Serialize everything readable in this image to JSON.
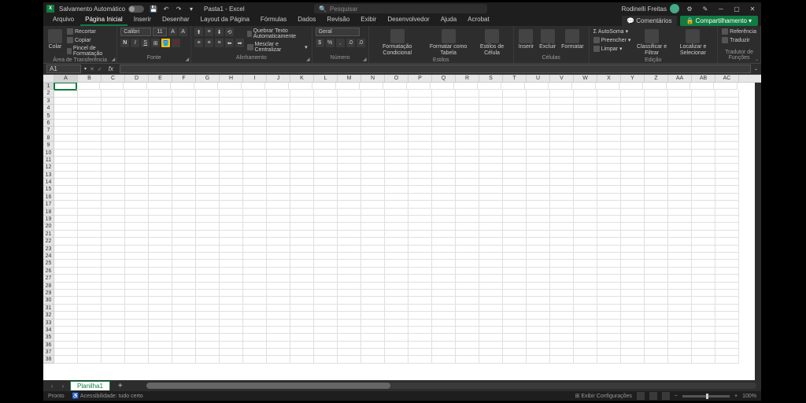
{
  "title": {
    "autosave": "Salvamento Automático",
    "filename": "Pasta1",
    "app": "Excel",
    "search_placeholder": "Pesquisar",
    "user": "Rodinelli Freitas"
  },
  "tabs": {
    "items": [
      "Arquivo",
      "Página Inicial",
      "Inserir",
      "Desenhar",
      "Layout da Página",
      "Fórmulas",
      "Dados",
      "Revisão",
      "Exibir",
      "Desenvolvedor",
      "Ajuda",
      "Acrobat"
    ],
    "active": 1,
    "comments": "Comentários",
    "share": "Compartilhamento"
  },
  "ribbon": {
    "clipboard": {
      "paste": "Colar",
      "cut": "Recortar",
      "copy": "Copiar",
      "painter": "Pincel de Formatação",
      "label": "Área de Transferência"
    },
    "font": {
      "name": "Calibri",
      "size": "11",
      "label": "Fonte"
    },
    "align": {
      "wrap": "Quebrar Texto Automaticamente",
      "merge": "Mesclar e Centralizar",
      "label": "Alinhamento"
    },
    "number": {
      "format": "Geral",
      "label": "Número"
    },
    "styles": {
      "cond": "Formatação Condicional",
      "table": "Formatar como Tabela",
      "cell": "Estilos de Célula",
      "label": "Estilos"
    },
    "cells": {
      "insert": "Inserir",
      "delete": "Excluir",
      "format": "Formatar",
      "label": "Células"
    },
    "editing": {
      "sum": "AutoSoma",
      "fill": "Preencher",
      "clear": "Limpar",
      "sort": "Classificar e Filtrar",
      "find": "Localizar e Selecionar",
      "label": "Edição"
    },
    "translator": {
      "ref": "Referência",
      "trans": "Traduzir",
      "label": "Tradutor de Funções"
    }
  },
  "formula": {
    "cell_ref": "A1"
  },
  "grid": {
    "cols": [
      "A",
      "B",
      "C",
      "D",
      "E",
      "F",
      "G",
      "H",
      "I",
      "J",
      "K",
      "L",
      "M",
      "N",
      "O",
      "P",
      "Q",
      "R",
      "S",
      "T",
      "U",
      "V",
      "W",
      "X",
      "Y",
      "Z",
      "AA",
      "AB",
      "AC"
    ],
    "row_count": 38,
    "active_col": 0,
    "active_row": 0
  },
  "sheets": {
    "active": "Planilha1"
  },
  "status": {
    "ready": "Pronto",
    "access": "Acessibilidade: tudo certo",
    "display": "Exibir Configurações",
    "zoom": "100%"
  }
}
